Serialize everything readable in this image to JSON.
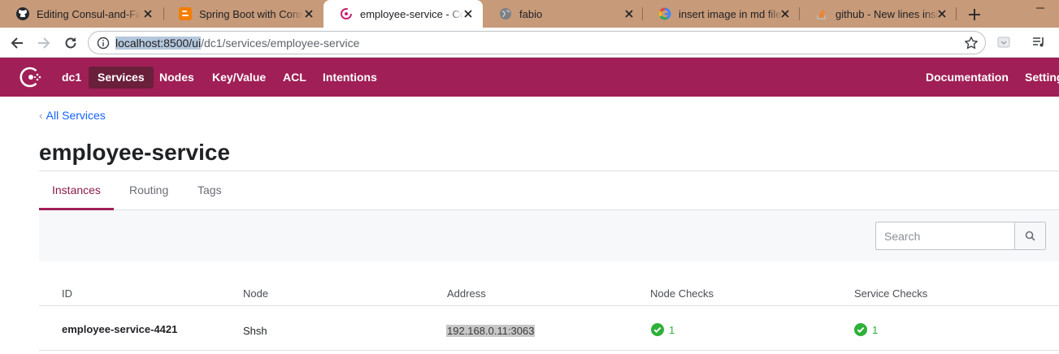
{
  "browser": {
    "tabs": [
      {
        "title": "Editing Consul-and-Fabio",
        "icon": "github-icon"
      },
      {
        "title": "Spring Boot with Consul",
        "icon": "blogger-icon"
      },
      {
        "title": "employee-service - Consul",
        "icon": "consul-icon",
        "active": true
      },
      {
        "title": "fabio",
        "icon": "globe-icon"
      },
      {
        "title": "insert image in md file -",
        "icon": "google-icon"
      },
      {
        "title": "github - New lines inside",
        "icon": "stackoverflow-icon"
      }
    ],
    "url_highlight": "localhost:8500/ui",
    "url_rest": "/dc1/services/employee-service"
  },
  "nav": {
    "datacenter": "dc1",
    "items": [
      "Services",
      "Nodes",
      "Key/Value",
      "ACL",
      "Intentions"
    ],
    "right_items": [
      "Documentation",
      "Settings"
    ]
  },
  "breadcrumb": "All Services",
  "page_title": "employee-service",
  "subtabs": [
    "Instances",
    "Routing",
    "Tags"
  ],
  "search": {
    "placeholder": "Search"
  },
  "table": {
    "headers": [
      "ID",
      "Node",
      "Address",
      "Node Checks",
      "Service Checks"
    ],
    "rows": [
      {
        "id": "employee-service-4421",
        "node": "Shsh",
        "address": "192.168.0.11:3063",
        "node_checks": "1",
        "service_checks": "1"
      }
    ]
  },
  "colors": {
    "brand": "#a01f56",
    "brand_dark": "#6a1f3b",
    "link": "#1563ff",
    "passing": "#2eb039",
    "tabstrip": "#c79a79"
  }
}
